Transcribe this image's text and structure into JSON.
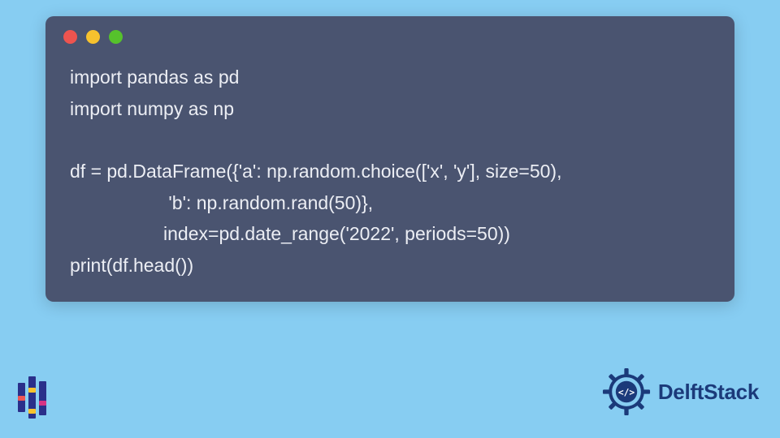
{
  "colors": {
    "background": "#87cdf2",
    "window_bg": "#4a5470",
    "code_text": "#eceef4",
    "dot_red": "#ee544f",
    "dot_yellow": "#f7c22e",
    "dot_green": "#56c22c",
    "brand_blue": "#1b3a7a"
  },
  "code": {
    "line1": "import pandas as pd",
    "line2": "import numpy as np",
    "line3": "",
    "line4": "df = pd.DataFrame({'a': np.random.choice(['x', 'y'], size=50),",
    "line5": "                   'b': np.random.rand(50)},",
    "line6": "                  index=pd.date_range('2022', periods=50))",
    "line7": "print(df.head())"
  },
  "brand": {
    "name": "DelftStack"
  },
  "icons": {
    "traffic_close": "close",
    "traffic_min": "minimize",
    "traffic_max": "maximize",
    "left_logo": "bars-logo",
    "right_logo": "delftstack-cog"
  }
}
